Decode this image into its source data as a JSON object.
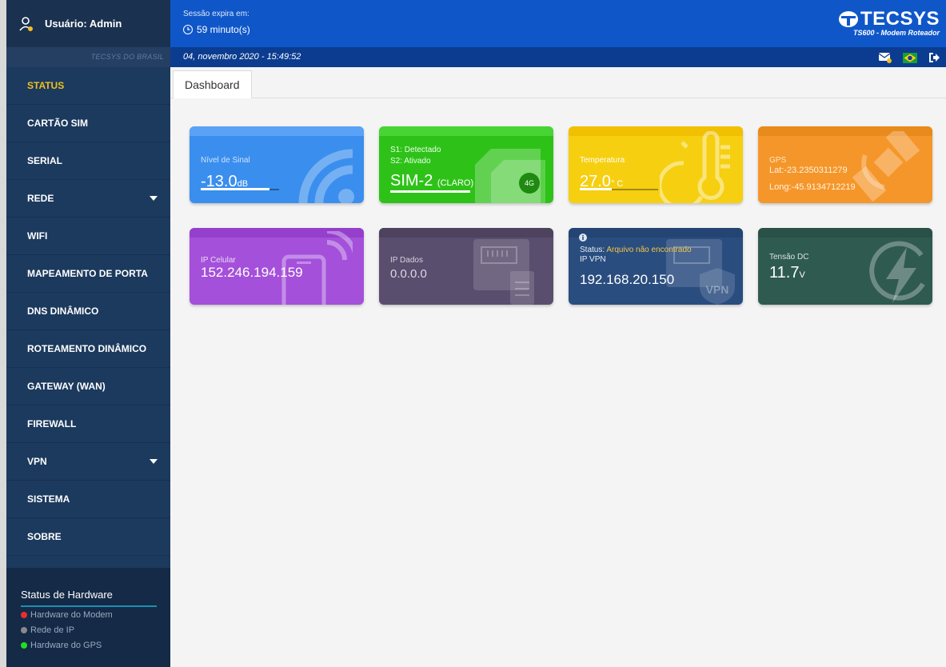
{
  "sidebar": {
    "user_label": "Usuário: Admin",
    "company": "TECSYS DO BRASIL",
    "menu": [
      {
        "label": "STATUS",
        "active": true,
        "expandable": false
      },
      {
        "label": "CARTÃO SIM",
        "active": false,
        "expandable": false
      },
      {
        "label": "SERIAL",
        "active": false,
        "expandable": false
      },
      {
        "label": "REDE",
        "active": false,
        "expandable": true
      },
      {
        "label": "WIFI",
        "active": false,
        "expandable": false
      },
      {
        "label": "MAPEAMENTO DE PORTA",
        "active": false,
        "expandable": false
      },
      {
        "label": "DNS DINÂMICO",
        "active": false,
        "expandable": false
      },
      {
        "label": "ROTEAMENTO DINÂMICO",
        "active": false,
        "expandable": false
      },
      {
        "label": "GATEWAY (WAN)",
        "active": false,
        "expandable": false
      },
      {
        "label": "FIREWALL",
        "active": false,
        "expandable": false
      },
      {
        "label": "VPN",
        "active": false,
        "expandable": true
      },
      {
        "label": "SISTEMA",
        "active": false,
        "expandable": false
      },
      {
        "label": "SOBRE",
        "active": false,
        "expandable": false
      }
    ],
    "hardware": {
      "title": "Status de Hardware",
      "items": [
        {
          "label": "Hardware do Modem",
          "color": "#e53030"
        },
        {
          "label": "Rede de IP",
          "color": "#8a8a8a"
        },
        {
          "label": "Hardware do GPS",
          "color": "#22dd22"
        }
      ]
    }
  },
  "header": {
    "session_label": "Sessão expira em:",
    "session_time": "59 minuto(s)",
    "logo": "TECSYS",
    "model": "TS600 - Modem Roteador",
    "datetime": "04, novembro 2020 - 15:49:52",
    "icons": [
      "mail-icon",
      "brazil-flag-icon",
      "logout-icon"
    ]
  },
  "tabs": [
    {
      "label": "Dashboard"
    }
  ],
  "cards": {
    "signal": {
      "label": "Nível de Sinal",
      "value": "-13.0",
      "unit": "dB",
      "color": "#3a8eee"
    },
    "sim": {
      "line1": "S1: Detectado",
      "line2": "S2: Ativado",
      "value": "SIM-2",
      "carrier": "(CLARO)",
      "badge": "4G",
      "color": "#2ec218"
    },
    "temperature": {
      "label": "Temperatura",
      "value": "27.0",
      "unit": "° C",
      "color": "#f6cf10"
    },
    "gps": {
      "label": "GPS",
      "lat": "Lat:-23.2350311279",
      "long": "Long:-45.9134712219",
      "color": "#f5962a"
    },
    "ip_cell": {
      "label": "IP Celular",
      "value": "152.246.194.159",
      "color": "#a450da"
    },
    "ip_data": {
      "label": "IP Dados",
      "value": "0.0.0.0",
      "color": "#5a4e6e"
    },
    "vpn": {
      "status_label": "Status:",
      "status_value": "Arquivo não encontrado",
      "label": "IP VPN",
      "value": "192.168.20.150",
      "badge": "VPN",
      "color": "#2a4d7f"
    },
    "voltage": {
      "label": "Tensão DC",
      "value": "11.7",
      "unit": "V",
      "color": "#2f5a50"
    }
  },
  "colors": {
    "accent": "#f0c020",
    "topbar": "#0f57c9",
    "sidebar": "#1c3a5e"
  }
}
